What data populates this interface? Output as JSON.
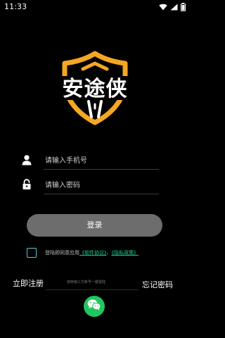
{
  "status_bar": {
    "time": "11:33"
  },
  "logo": {
    "text": "安途侠"
  },
  "phone_field": {
    "placeholder": "请输入手机号",
    "value": ""
  },
  "password_field": {
    "placeholder": "请输入密码",
    "value": ""
  },
  "login_button": {
    "label": "登录"
  },
  "agreement": {
    "checked": false,
    "prefix": "登陆即同意应用",
    "software_agreement": "《软件协议》",
    "separator": "、",
    "privacy_policy": "《隐私政策》"
  },
  "footer": {
    "register_label": "立即注册",
    "forgot_password_label": "忘记密码",
    "third_party_hint": "使用第三方账号一键登陆"
  },
  "colors": {
    "background": "#000000",
    "logo_orange": "#f5a623",
    "login_button_bg": "#6d6d6d",
    "checkbox_border": "#5fc6d6",
    "link": "#20c997",
    "wechat": "#22c55e"
  },
  "icons": {
    "status": [
      "wifi-icon",
      "signal-icon",
      "battery-icon"
    ],
    "phone_field": "user-icon",
    "password_field": "lock-icon",
    "social": "wechat-icon"
  }
}
